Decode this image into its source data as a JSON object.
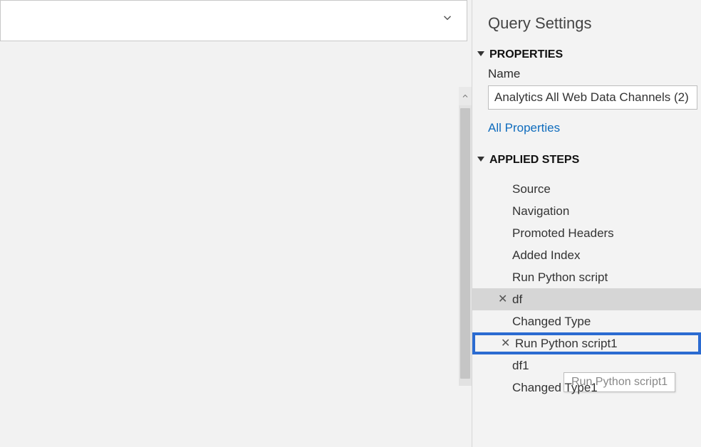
{
  "panel": {
    "title": "Query Settings",
    "properties": {
      "header": "PROPERTIES",
      "name_label": "Name",
      "name_value": "Analytics All Web Data Channels (2)",
      "all_properties_link": "All Properties"
    },
    "applied_steps": {
      "header": "APPLIED STEPS",
      "items": [
        {
          "label": "Source",
          "has_delete": false,
          "state": "normal"
        },
        {
          "label": "Navigation",
          "has_delete": false,
          "state": "normal"
        },
        {
          "label": "Promoted Headers",
          "has_delete": false,
          "state": "normal"
        },
        {
          "label": "Added Index",
          "has_delete": false,
          "state": "normal"
        },
        {
          "label": "Run Python script",
          "has_delete": false,
          "state": "normal"
        },
        {
          "label": "df",
          "has_delete": true,
          "state": "selected"
        },
        {
          "label": "Changed Type",
          "has_delete": false,
          "state": "normal"
        },
        {
          "label": "Run Python script1",
          "has_delete": true,
          "state": "highlighted"
        },
        {
          "label": "df1",
          "has_delete": false,
          "state": "normal"
        },
        {
          "label": "Changed Type1",
          "has_delete": false,
          "state": "normal"
        }
      ],
      "tooltip": "Run Python script1"
    }
  }
}
